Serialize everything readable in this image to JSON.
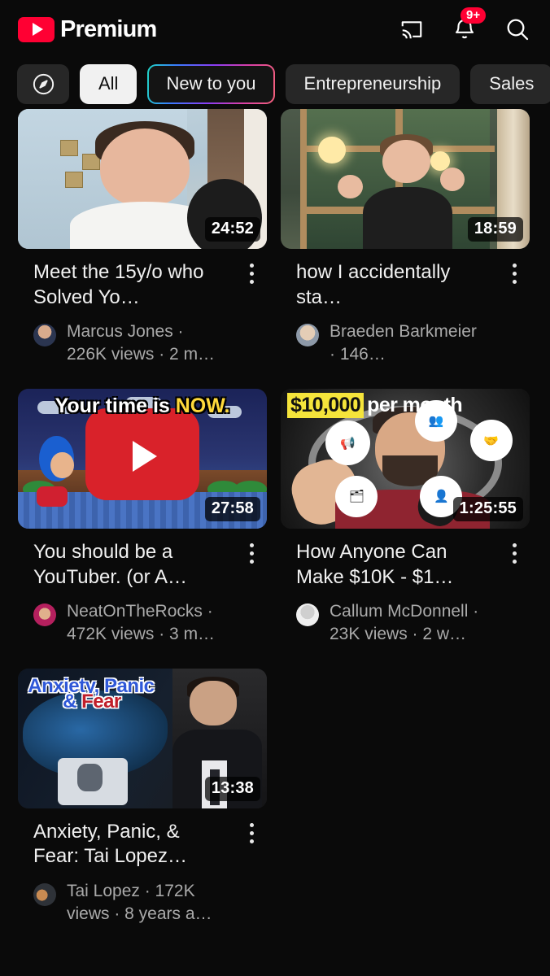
{
  "header": {
    "brand_text": "Premium",
    "logo_icon": "youtube-play-icon",
    "cast_icon": "cast-icon",
    "notifications_icon": "bell-icon",
    "notifications_badge": "9+",
    "search_icon": "search-icon",
    "accent_color": "#ff0033"
  },
  "chips": [
    {
      "label": "",
      "icon": "compass-explore-icon",
      "type": "icon",
      "selected": false
    },
    {
      "label": "All",
      "type": "text",
      "selected": true
    },
    {
      "label": "New to you",
      "type": "gradient",
      "selected": false
    },
    {
      "label": "Entrepreneurship",
      "type": "text",
      "selected": false
    },
    {
      "label": "Sales",
      "type": "text",
      "selected": false
    }
  ],
  "videos": [
    {
      "title": "Meet the 15y/o who Solved Yo…",
      "duration": "24:52",
      "channel_meta": "Marcus Jones · 226K views · 2 m…",
      "channel": "Marcus Jones",
      "views": "226K views",
      "age": "2 m…",
      "menu_icon": "kebab-menu-icon",
      "thumb_overlay_text": ""
    },
    {
      "title": "how I accidentally sta…",
      "duration": "18:59",
      "channel_meta": "Braeden Barkmeier · 146…",
      "channel": "Braeden Barkmeier",
      "views": "146…",
      "age": "",
      "menu_icon": "kebab-menu-icon",
      "thumb_overlay_text": ""
    },
    {
      "title": "You should be a YouTuber. (or A…",
      "duration": "27:58",
      "channel_meta": "NeatOnTheRocks · 472K views · 3 m…",
      "channel": "NeatOnTheRocks",
      "views": "472K views",
      "age": "3 m…",
      "menu_icon": "kebab-menu-icon",
      "thumb_overlay_text": "Your time is NOW.",
      "thumb_overlay_plain": "Your time is ",
      "thumb_overlay_accent": "NOW."
    },
    {
      "title": "How Anyone Can Make $10K - $1…",
      "duration": "1:25:55",
      "channel_meta": "Callum McDonnell · 23K views · 2 w…",
      "channel": "Callum McDonnell",
      "views": "23K views",
      "age": "2 w…",
      "menu_icon": "kebab-menu-icon",
      "thumb_overlay_highlight": "$10,000",
      "thumb_overlay_rest": "per month"
    },
    {
      "title": "Anxiety, Panic, & Fear: Tai Lopez…",
      "duration": "13:38",
      "channel_meta": "Tai Lopez · 172K views · 8 years a…",
      "channel": "Tai Lopez",
      "views": "172K views",
      "age": "8 years a…",
      "menu_icon": "kebab-menu-icon",
      "thumb_overlay_line1": "Anxiety, Panic",
      "thumb_overlay_amp": "& ",
      "thumb_overlay_fear": "Fear"
    }
  ]
}
